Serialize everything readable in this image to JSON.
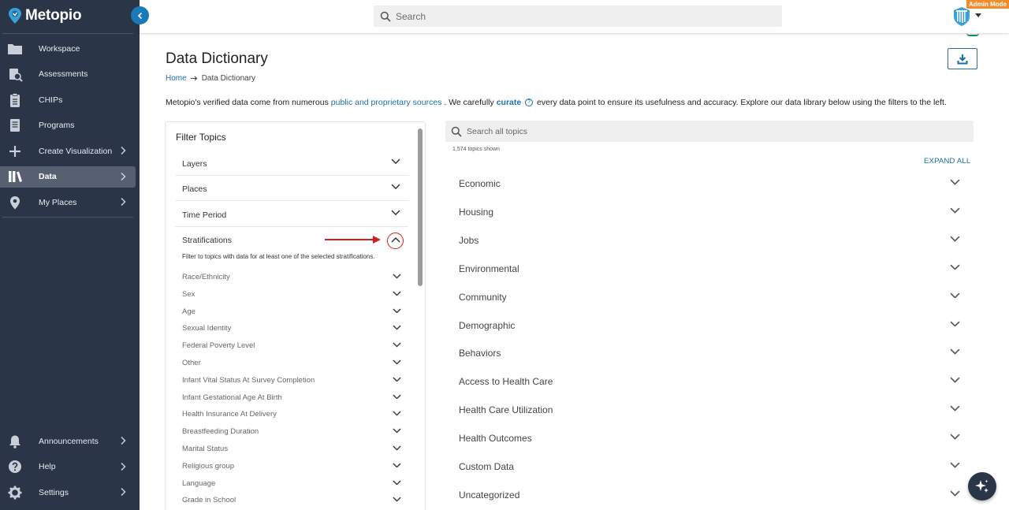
{
  "app": {
    "name": "Metopio",
    "admin_badge": "Admin Mode"
  },
  "search": {
    "placeholder": "Search"
  },
  "sidebar": {
    "items": [
      {
        "label": "Workspace",
        "icon": "folder-icon",
        "chevron": false,
        "active": false
      },
      {
        "label": "Assessments",
        "icon": "assessment-icon",
        "chevron": false,
        "active": false
      },
      {
        "label": "CHIPs",
        "icon": "clipboard-icon",
        "chevron": false,
        "active": false
      },
      {
        "label": "Programs",
        "icon": "document-icon",
        "chevron": false,
        "active": false
      },
      {
        "label": "Create Visualization",
        "icon": "plus-icon",
        "chevron": true,
        "active": false
      },
      {
        "label": "Data",
        "icon": "library-icon",
        "chevron": true,
        "active": true
      },
      {
        "label": "My Places",
        "icon": "location-pin-icon",
        "chevron": true,
        "active": false
      }
    ],
    "bottom_items": [
      {
        "label": "Announcements",
        "icon": "bell-icon",
        "chevron": true
      },
      {
        "label": "Help",
        "icon": "help-icon",
        "chevron": true
      },
      {
        "label": "Settings",
        "icon": "gear-icon",
        "chevron": true
      }
    ]
  },
  "page": {
    "title": "Data Dictionary",
    "breadcrumb": {
      "home": "Home",
      "current": "Data Dictionary"
    },
    "intro": {
      "part1": "Metopio's verified data come from numerous ",
      "link1": "public and proprietary sources",
      "part2": " . We carefully ",
      "curate": "curate",
      "part3": " every data point to ensure its usefulness and accuracy. Explore our data library below using the filters to the left."
    }
  },
  "filters": {
    "title": "Filter Topics",
    "sections": [
      {
        "label": "Layers",
        "expanded": false
      },
      {
        "label": "Places",
        "expanded": false
      },
      {
        "label": "Time Period",
        "expanded": false
      },
      {
        "label": "Stratifications",
        "expanded": true
      }
    ],
    "stratifications_description": "Filter to topics with data for at least one of the selected stratifications.",
    "stratifications": [
      "Race/Ethnicity",
      "Sex",
      "Age",
      "Sexual Identity",
      "Federal Poverty Level",
      "Other",
      "Infant Vital Status At Survey Completion",
      "Infant Gestational Age At Birth",
      "Health Insurance At Delivery",
      "Breastfeeding Duration",
      "Marital Status",
      "Religious group",
      "Language",
      "Grade in School"
    ]
  },
  "topics": {
    "search_placeholder": "Search all topics",
    "count_text": "1,574 topics shown",
    "expand_all": "EXPAND ALL",
    "categories": [
      "Economic",
      "Housing",
      "Jobs",
      "Environmental",
      "Community",
      "Demographic",
      "Behaviors",
      "Access to Health Care",
      "Health Care Utilization",
      "Health Outcomes",
      "Custom Data",
      "Uncategorized"
    ]
  },
  "colors": {
    "sidebar_bg": "#2b3548",
    "accent": "#1a6fa5",
    "admin_badge": "#f28c28",
    "annotation_red": "#d21f1f"
  }
}
